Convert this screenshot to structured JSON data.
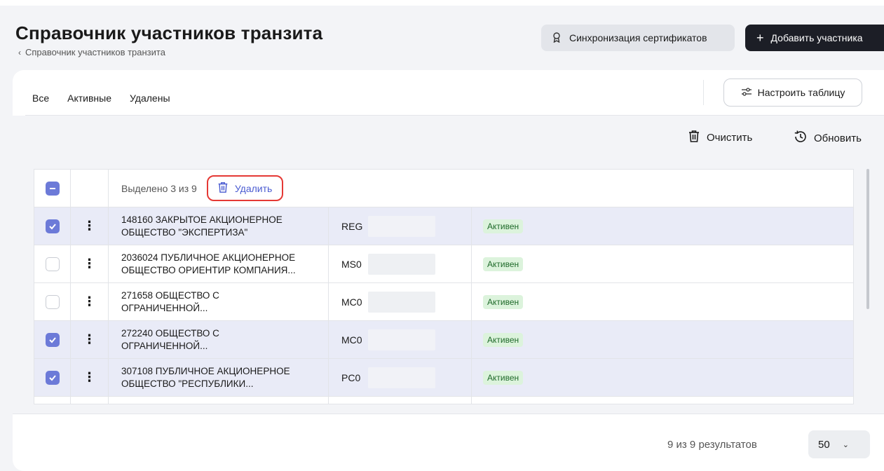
{
  "header": {
    "title": "Справочник участников транзита",
    "breadcrumb": "Справочник участников транзита",
    "sync_label": "Синхронизация сертификатов",
    "add_label": "Добавить участника"
  },
  "tabs": [
    {
      "label": "Все",
      "active": true
    },
    {
      "label": "Активные",
      "active": false
    },
    {
      "label": "Удалены",
      "active": false
    }
  ],
  "config_label": "Настроить таблицу",
  "toolbar": {
    "clear_label": "Очистить",
    "refresh_label": "Обновить"
  },
  "table": {
    "selection_text": "Выделено 3 из 9",
    "delete_label": "Удалить",
    "rows": [
      {
        "checked": true,
        "name_line1": "148160 ЗАКРЫТОЕ АКЦИОНЕРНОЕ",
        "name_line2": "ОБЩЕСТВО \"ЭКСПЕРТИЗА\"",
        "code": "REG",
        "status": "Активен"
      },
      {
        "checked": false,
        "name_line1": "2036024 ПУБЛИЧНОЕ АКЦИОНЕРНОЕ",
        "name_line2": "ОБЩЕСТВО ОРИЕНТИР КОМПАНИЯ...",
        "code": "MS0",
        "status": "Активен"
      },
      {
        "checked": false,
        "name_line1": "271658 ОБЩЕСТВО С",
        "name_line2": "ОГРАНИЧЕННОЙ...",
        "code": "MC0",
        "status": "Активен"
      },
      {
        "checked": true,
        "name_line1": "272240 ОБЩЕСТВО С",
        "name_line2": "ОГРАНИЧЕННОЙ...",
        "code": "MC0",
        "status": "Активен"
      },
      {
        "checked": true,
        "name_line1": "307108 ПУБЛИЧНОЕ АКЦИОНЕРНОЕ",
        "name_line2": "ОБЩЕСТВО \"РЕСПУБЛИКИ...",
        "code": "PC0",
        "status": "Активен"
      }
    ]
  },
  "footer": {
    "results": "9 из 9 результатов",
    "page_size": "50"
  },
  "colors": {
    "accent": "#6c7ad8",
    "primary_button": "#1c1e26",
    "highlight": "#e53935",
    "status_bg": "#dcf3dc"
  }
}
